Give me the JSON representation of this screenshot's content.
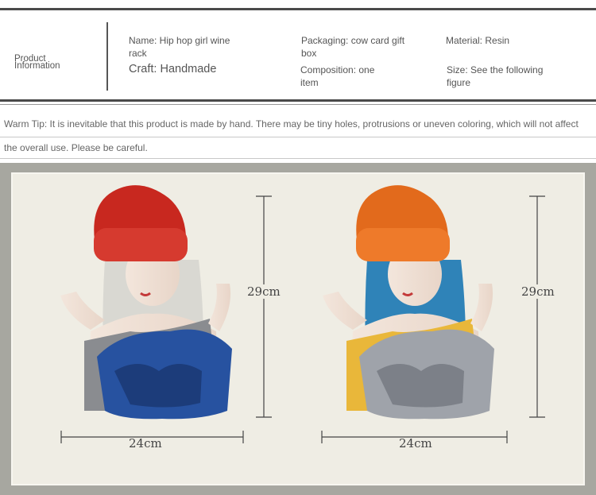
{
  "product_info": {
    "heading_line1": "Product",
    "heading_line2": "Information",
    "name": "Name: Hip hop girl wine rack",
    "craft": "Craft: Handmade",
    "packaging": "Packaging: cow card gift box",
    "composition": "Composition: one item",
    "material": "Material: Resin",
    "size": "Size: See the following figure"
  },
  "warm_tip": {
    "line1": "Warm Tip: It is inevitable that this product is made by hand. There may be tiny holes, protrusions or uneven coloring, which will not affect",
    "line2": "the overall use. Please be careful."
  },
  "figures": [
    {
      "height_label": "29cm",
      "width_label": "24cm",
      "colors": {
        "hat": "#c8281f",
        "hat_cuff": "#d63a2f",
        "hair": "#d9d8d2",
        "shirt": "#8a8c90",
        "bowl": "#2752a0",
        "bowl_dark": "#1c3c7a"
      }
    },
    {
      "height_label": "29cm",
      "width_label": "24cm",
      "colors": {
        "hat": "#e26a1c",
        "hat_cuff": "#ee7a2a",
        "hair": "#2f83b8",
        "shirt": "#e9b73a",
        "bowl": "#9fa3aa",
        "bowl_dark": "#7c8088"
      }
    }
  ]
}
